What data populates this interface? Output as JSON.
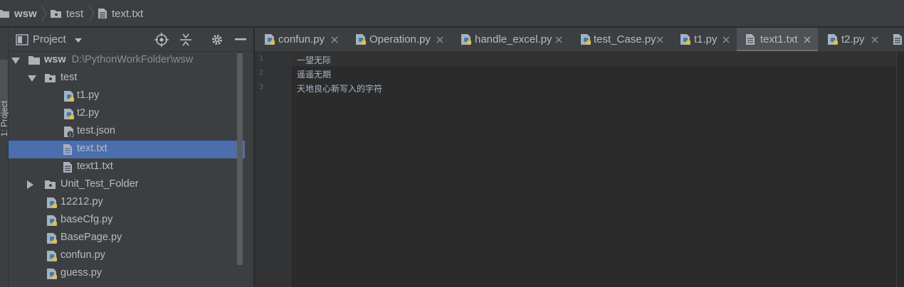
{
  "breadcrumb": [
    {
      "label": "wsw",
      "icon": "folder-icon",
      "bold": true
    },
    {
      "label": "test",
      "icon": "package-folder-icon",
      "bold": false
    },
    {
      "label": "text.txt",
      "icon": "text-file-icon",
      "bold": false
    }
  ],
  "tool_stripe": {
    "label": "1: Project"
  },
  "project_panel": {
    "title": "Project",
    "toolbar_icons": [
      "chevron-down-icon",
      "locate-icon",
      "collapse-all-icon",
      "gear-icon",
      "minimize-icon"
    ],
    "root_path": "D:\\PythonWorkFolder\\wsw",
    "tree": [
      {
        "label": "wsw",
        "type": "folder",
        "expanded": true,
        "bold": true
      },
      {
        "label": "test",
        "type": "package",
        "expanded": true
      },
      {
        "label": "t1.py",
        "type": "python"
      },
      {
        "label": "t2.py",
        "type": "python"
      },
      {
        "label": "test.json",
        "type": "json"
      },
      {
        "label": "text.txt",
        "type": "text",
        "selected": true
      },
      {
        "label": "text1.txt",
        "type": "text"
      },
      {
        "label": "Unit_Test_Folder",
        "type": "package",
        "expanded": false
      },
      {
        "label": "12212.py",
        "type": "python"
      },
      {
        "label": "baseCfg.py",
        "type": "python"
      },
      {
        "label": "BasePage.py",
        "type": "python"
      },
      {
        "label": "confun.py",
        "type": "python"
      },
      {
        "label": "guess.py",
        "type": "python"
      }
    ]
  },
  "tabs": [
    {
      "label": "confun.py",
      "type": "python"
    },
    {
      "label": "Operation.py",
      "type": "python"
    },
    {
      "label": "handle_excel.py",
      "type": "python"
    },
    {
      "label": "test_Case.py",
      "type": "python"
    },
    {
      "label": "t1.py",
      "type": "python"
    },
    {
      "label": "text1.txt",
      "type": "text",
      "active": true
    },
    {
      "label": "t2.py",
      "type": "python"
    }
  ],
  "editor": {
    "lines": [
      {
        "number": "1",
        "text": "一望无际"
      },
      {
        "number": "2",
        "text": "遥遥无期"
      },
      {
        "number": "3",
        "text": "天地良心新写入的字符"
      }
    ]
  },
  "colors": {
    "panel_bg": "#3c3f41",
    "editor_bg": "#2b2b2b",
    "selection": "#4b6eaf",
    "text": "#bbbbbb"
  }
}
